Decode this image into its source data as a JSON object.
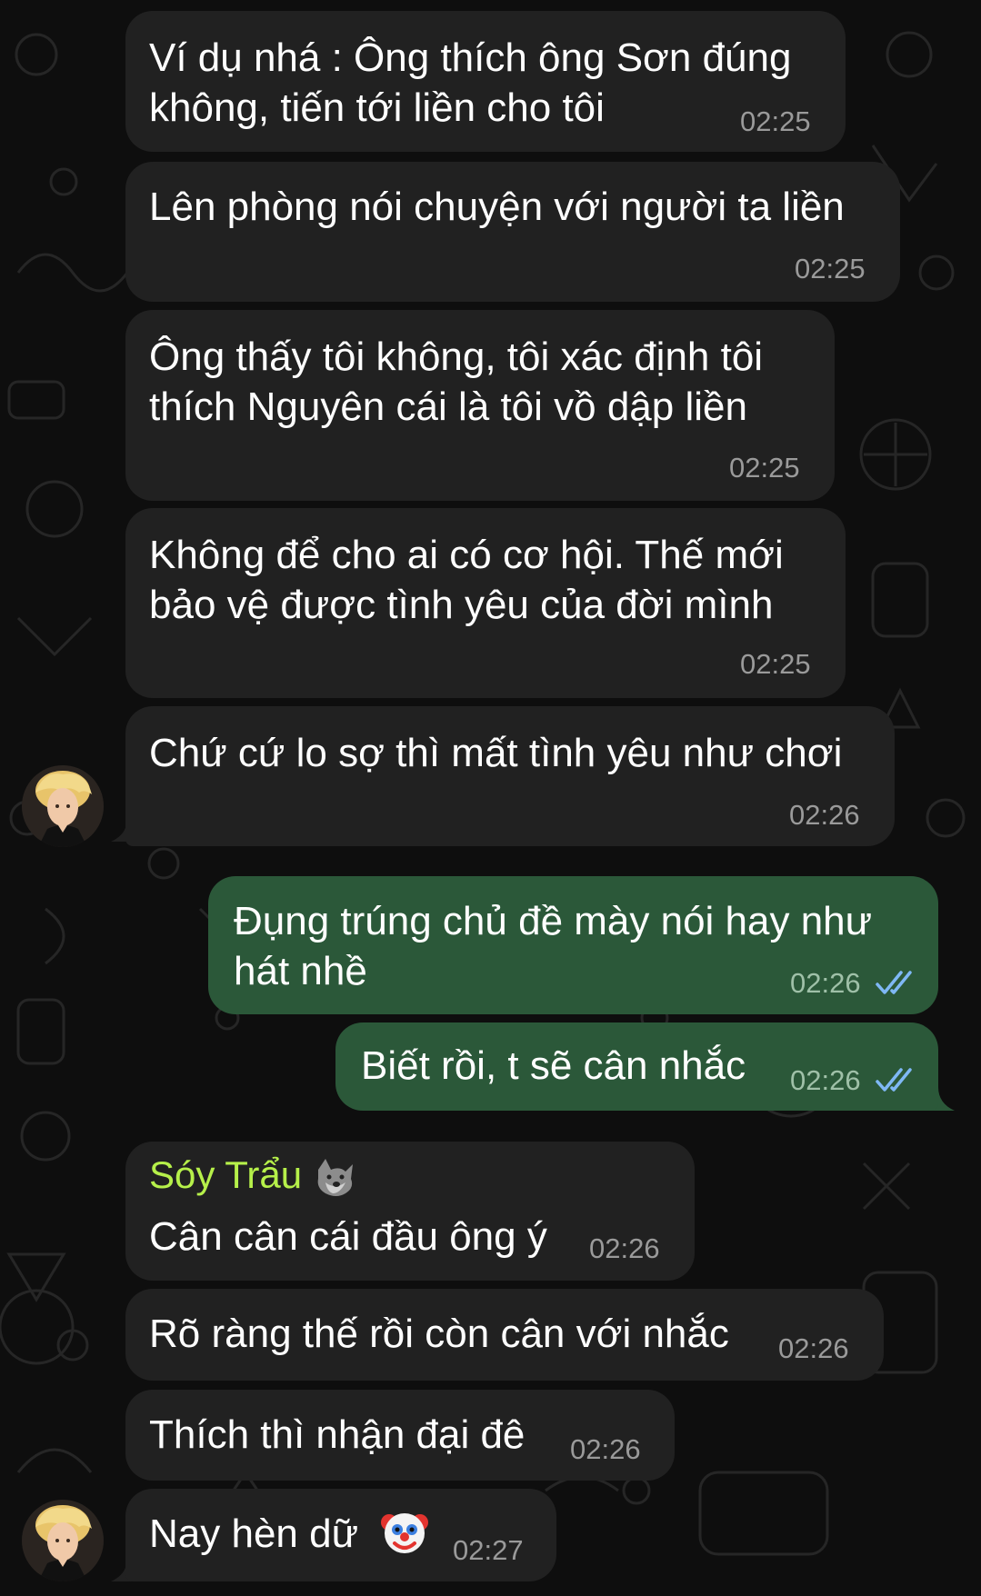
{
  "colors": {
    "incoming_bubble": "#212121",
    "outgoing_bubble": "#2b5839",
    "time_incoming": "#9a9a9a",
    "time_outgoing": "#9fc0a8",
    "sender_name": "#b6f04a",
    "read_ticks": "#7fb8f5"
  },
  "messages": [
    {
      "direction": "incoming",
      "lines": [
        "Ví dụ nhá : Ông thích ông Sơn đúng",
        "không, tiến tới liền cho tôi"
      ],
      "time": "02:25"
    },
    {
      "direction": "incoming",
      "lines": [
        "Lên phòng nói chuyện với người ta liền"
      ],
      "time": "02:25"
    },
    {
      "direction": "incoming",
      "lines": [
        "Ông thấy tôi không, tôi xác định tôi",
        "thích Nguyên cái là tôi vồ dập liền"
      ],
      "time": "02:25"
    },
    {
      "direction": "incoming",
      "lines": [
        "Không để cho ai có cơ hội. Thế mới",
        "bảo vệ được tình yêu của đời mình"
      ],
      "time": "02:25"
    },
    {
      "direction": "incoming",
      "lines": [
        "Chứ cứ lo sợ thì mất tình yêu như chơi"
      ],
      "time": "02:26"
    },
    {
      "direction": "outgoing",
      "lines": [
        "Đụng trúng chủ đề mày nói hay như",
        "hát nhề"
      ],
      "time": "02:26",
      "status": "read-double-check"
    },
    {
      "direction": "outgoing",
      "lines": [
        "Biết rồi, t sẽ cân nhắc"
      ],
      "time": "02:26",
      "status": "read-double-check"
    },
    {
      "direction": "incoming",
      "sender": "Sóy Trẩu",
      "sender_emoji": "wolf-emoji",
      "lines": [
        "Cân cân cái đầu ông ý"
      ],
      "time": "02:26"
    },
    {
      "direction": "incoming",
      "lines": [
        "Rõ ràng thế rồi còn cân với nhắc"
      ],
      "time": "02:26"
    },
    {
      "direction": "incoming",
      "lines": [
        "Thích thì nhận đại đê"
      ],
      "time": "02:26"
    },
    {
      "direction": "incoming",
      "lines": [
        "Nay hèn dữ"
      ],
      "emoji": "clown-face-emoji",
      "time": "02:27"
    }
  ]
}
